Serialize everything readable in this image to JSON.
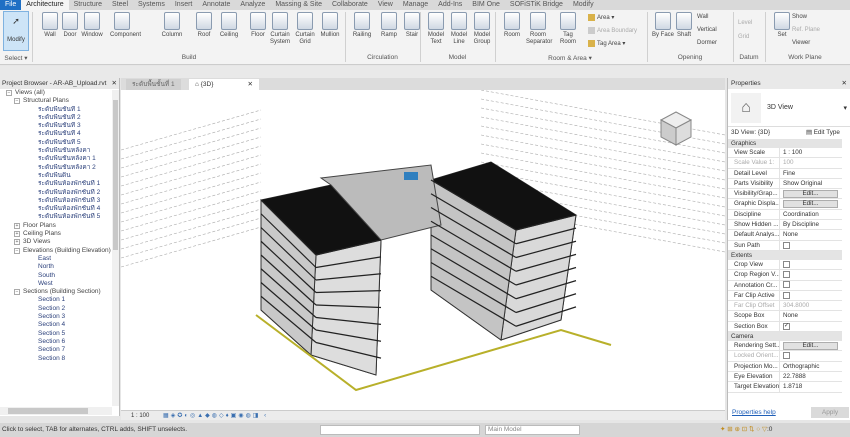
{
  "menu": {
    "tabs": [
      "File",
      "Architecture",
      "Structure",
      "Steel",
      "Systems",
      "Insert",
      "Annotate",
      "Analyze",
      "Massing & Site",
      "Collaborate",
      "View",
      "Manage",
      "Add-Ins",
      "BIM One",
      "SOFiSTiK Bridge",
      "Modify"
    ],
    "active": "Architecture"
  },
  "ribbon": {
    "select": {
      "modify": "Modify",
      "label": "Select ▾"
    },
    "build": {
      "label": "Build",
      "buttons": [
        "Wall",
        "Door",
        "Window",
        "Component",
        "Column",
        "Roof",
        "Ceiling",
        "Floor",
        "Curtain System",
        "Curtain Grid",
        "Mullion"
      ]
    },
    "circulation": {
      "label": "Circulation",
      "buttons": [
        "Railing",
        "Ramp",
        "Stair"
      ]
    },
    "model": {
      "label": "Model",
      "buttons": [
        "Model Text",
        "Model Line",
        "Model Group"
      ]
    },
    "room_area": {
      "label": "Room & Area ▾",
      "buttons": [
        "Room",
        "Room Separator",
        "Tag Room"
      ],
      "small": [
        "Area ▾",
        "Area Boundary",
        "Tag Area ▾"
      ]
    },
    "opening": {
      "label": "Opening",
      "buttons": [
        "By Face",
        "Shaft"
      ],
      "small": [
        "Wall",
        "Vertical",
        "Dormer"
      ]
    },
    "datum": {
      "label": "Datum",
      "small": [
        "Level",
        "Grid"
      ]
    },
    "work_plane": {
      "label": "Work Plane",
      "buttons": [
        "Set"
      ],
      "small": [
        "Show",
        "Ref. Plane",
        "Viewer"
      ]
    }
  },
  "project_browser": {
    "title": "Project Browser - AR-AB_Upload.rvt",
    "root": "Views (all)",
    "structural_plans": {
      "label": "Structural Plans",
      "items": [
        "ระดับพื้นชั้นที่ 1",
        "ระดับพื้นชั้นที่ 2",
        "ระดับพื้นชั้นที่ 3",
        "ระดับพื้นชั้นที่ 4",
        "ระดับพื้นชั้นที่ 5",
        "ระดับพื้นชั้นหลังคา",
        "ระดับพื้นชั้นหลังคา 1",
        "ระดับพื้นชั้นหลังคา 2",
        "ระดับพื้นดิน",
        "ระดับพื้นห้องพักชั้นที่ 1",
        "ระดับพื้นห้องพักชั้นที่ 2",
        "ระดับพื้นห้องพักชั้นที่ 3",
        "ระดับพื้นห้องพักชั้นที่ 4",
        "ระดับพื้นห้องพักชั้นที่ 5"
      ]
    },
    "collapsed": [
      "Floor Plans",
      "Ceiling Plans",
      "3D Views"
    ],
    "elevations": {
      "label": "Elevations (Building Elevation)",
      "items": [
        "East",
        "North",
        "South",
        "West"
      ]
    },
    "sections": {
      "label": "Sections (Building Section)",
      "items": [
        "Section 1",
        "Section 2",
        "Section 3",
        "Section 4",
        "Section 5",
        "Section 6",
        "Section 7",
        "Section 8"
      ]
    }
  },
  "view_tabs": [
    {
      "label": "ระดับพื้นชั้นที่ 1"
    },
    {
      "label": "{3D}",
      "active": true
    }
  ],
  "view_control": {
    "scale": "1 : 100"
  },
  "properties": {
    "title": "Properties",
    "type": "3D View",
    "selector": "3D View: {3D}",
    "edit_type": "Edit Type",
    "graphics": {
      "label": "Graphics",
      "rows": [
        [
          "View Scale",
          "1 : 100"
        ],
        [
          "Scale Value  1:",
          "100"
        ],
        [
          "Detail Level",
          "Fine"
        ],
        [
          "Parts Visibility",
          "Show Original"
        ],
        [
          "Visibility/Grap...",
          "Edit..."
        ],
        [
          "Graphic Displa...",
          "Edit..."
        ],
        [
          "Discipline",
          "Coordination"
        ],
        [
          "Show Hidden ...",
          "By Discipline"
        ],
        [
          "Default Analys...",
          "None"
        ],
        [
          "Sun Path",
          ""
        ]
      ]
    },
    "extents": {
      "label": "Extents",
      "rows": [
        [
          "Crop View",
          ""
        ],
        [
          "Crop Region V...",
          ""
        ],
        [
          "Annotation Cr...",
          ""
        ],
        [
          "Far Clip Active",
          ""
        ],
        [
          "Far Clip Offset",
          "304.8000"
        ],
        [
          "Scope Box",
          "None"
        ],
        [
          "Section Box",
          "✓"
        ]
      ]
    },
    "camera": {
      "label": "Camera",
      "rows": [
        [
          "Rendering Sett...",
          "Edit..."
        ],
        [
          "Locked Orient...",
          ""
        ],
        [
          "Projection Mo...",
          "Orthographic"
        ],
        [
          "Eye Elevation",
          "22.7888"
        ],
        [
          "Target Elevation",
          "1.8718"
        ]
      ]
    },
    "help": "Properties help",
    "apply": "Apply"
  },
  "status": {
    "message": "Click to select, TAB for alternates, CTRL adds, SHIFT unselects.",
    "workset": "Main Model",
    "filter_count": ":0"
  }
}
